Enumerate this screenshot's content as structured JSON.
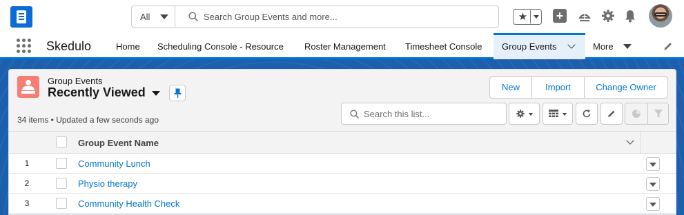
{
  "global_header": {
    "search_scope": "All",
    "search_placeholder": "Search Group Events and more...",
    "icons": [
      "app-logo-icon",
      "search-icon",
      "star-icon",
      "plus-icon",
      "trailhead-icon",
      "gear-icon",
      "bell-icon",
      "avatar"
    ]
  },
  "nav": {
    "app_name": "Skedulo",
    "items": [
      {
        "label": "Home"
      },
      {
        "label": "Scheduling Console - Resource"
      },
      {
        "label": "Roster Management"
      },
      {
        "label": "Timesheet Console"
      },
      {
        "label": "Group Events",
        "active": true
      }
    ],
    "more_label": "More"
  },
  "list_view": {
    "object_label": "Group Events",
    "view_name": "Recently Viewed",
    "meta": "34 items • Updated a few seconds ago",
    "buttons": [
      "New",
      "Import",
      "Change Owner"
    ],
    "search_placeholder": "Search this list...",
    "columns": [
      "Group Event Name"
    ],
    "rows": [
      {
        "num": "1",
        "name": "Community Lunch"
      },
      {
        "num": "2",
        "name": "Physio therapy"
      },
      {
        "num": "3",
        "name": "Community Health Check"
      }
    ]
  },
  "colors": {
    "brand_blue": "#0176d3",
    "logo_blue": "#0b6cd6",
    "band_blue": "#1b5fae",
    "object_icon": "#f77e75"
  }
}
